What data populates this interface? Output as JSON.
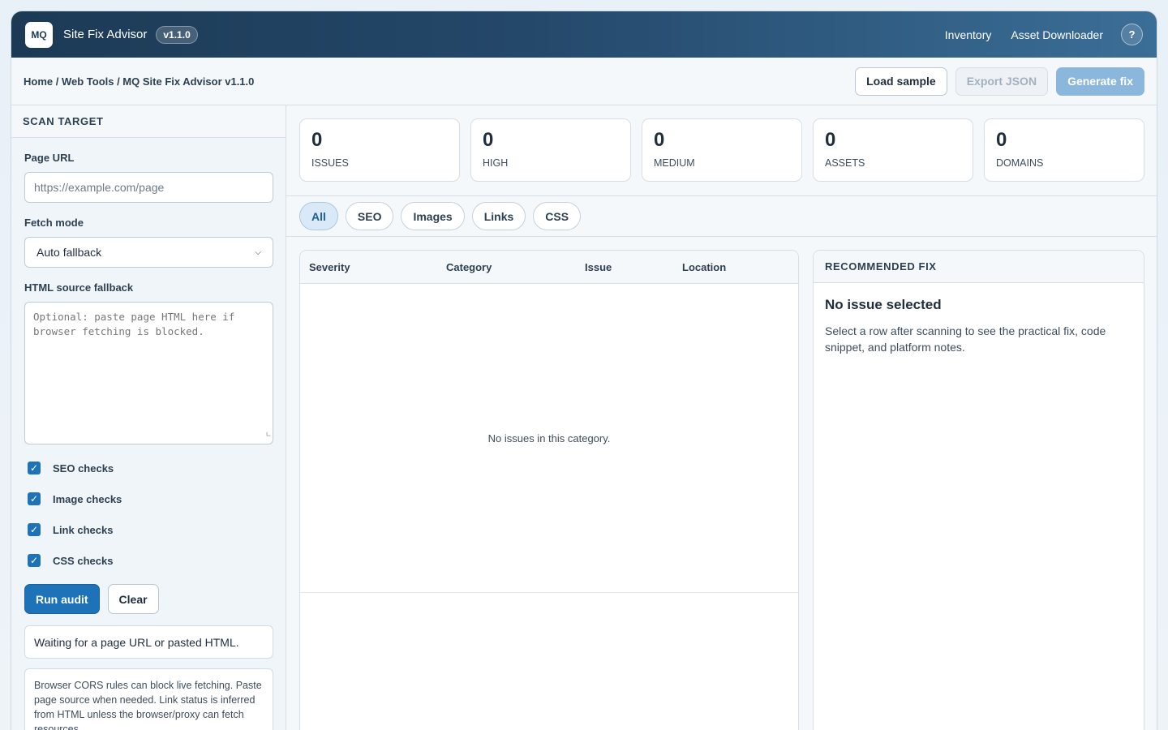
{
  "header": {
    "logo_text": "MQ",
    "app_name": "Site Fix Advisor",
    "version": "v1.1.0",
    "nav": [
      "Inventory",
      "Asset Downloader"
    ],
    "help_label": "?"
  },
  "breadcrumb": "Home / Web Tools / MQ Site Fix Advisor v1.1.0",
  "toolbar": {
    "load_sample": "Load sample",
    "export_json": "Export JSON",
    "generate_fix": "Generate fix"
  },
  "sidebar": {
    "title": "SCAN TARGET",
    "url_label": "Page URL",
    "url_placeholder": "https://example.com/page",
    "fetch_label": "Fetch mode",
    "fetch_value": "Auto fallback",
    "html_label": "HTML source fallback",
    "html_placeholder": "Optional: paste page HTML here if browser fetching is blocked.",
    "checks": [
      {
        "label": "SEO checks",
        "checked": true
      },
      {
        "label": "Image checks",
        "checked": true
      },
      {
        "label": "Link checks",
        "checked": true
      },
      {
        "label": "CSS checks",
        "checked": true
      }
    ],
    "run_label": "Run audit",
    "clear_label": "Clear",
    "status": "Waiting for a page URL or pasted HTML.",
    "note": "Browser CORS rules can block live fetching. Paste page source when needed. Link status is inferred from HTML unless the browser/proxy can fetch resources."
  },
  "stats": [
    {
      "value": "0",
      "label": "ISSUES"
    },
    {
      "value": "0",
      "label": "HIGH"
    },
    {
      "value": "0",
      "label": "MEDIUM"
    },
    {
      "value": "0",
      "label": "ASSETS"
    },
    {
      "value": "0",
      "label": "DOMAINS"
    }
  ],
  "tabs": [
    "All",
    "SEO",
    "Images",
    "Links",
    "CSS"
  ],
  "active_tab": "All",
  "table": {
    "columns": [
      "Severity",
      "Category",
      "Issue",
      "Location"
    ],
    "empty": "No issues in this category."
  },
  "fix": {
    "title": "RECOMMENDED FIX",
    "heading": "No issue selected",
    "text": "Select a row after scanning to see the practical fix, code snippet, and platform notes."
  }
}
